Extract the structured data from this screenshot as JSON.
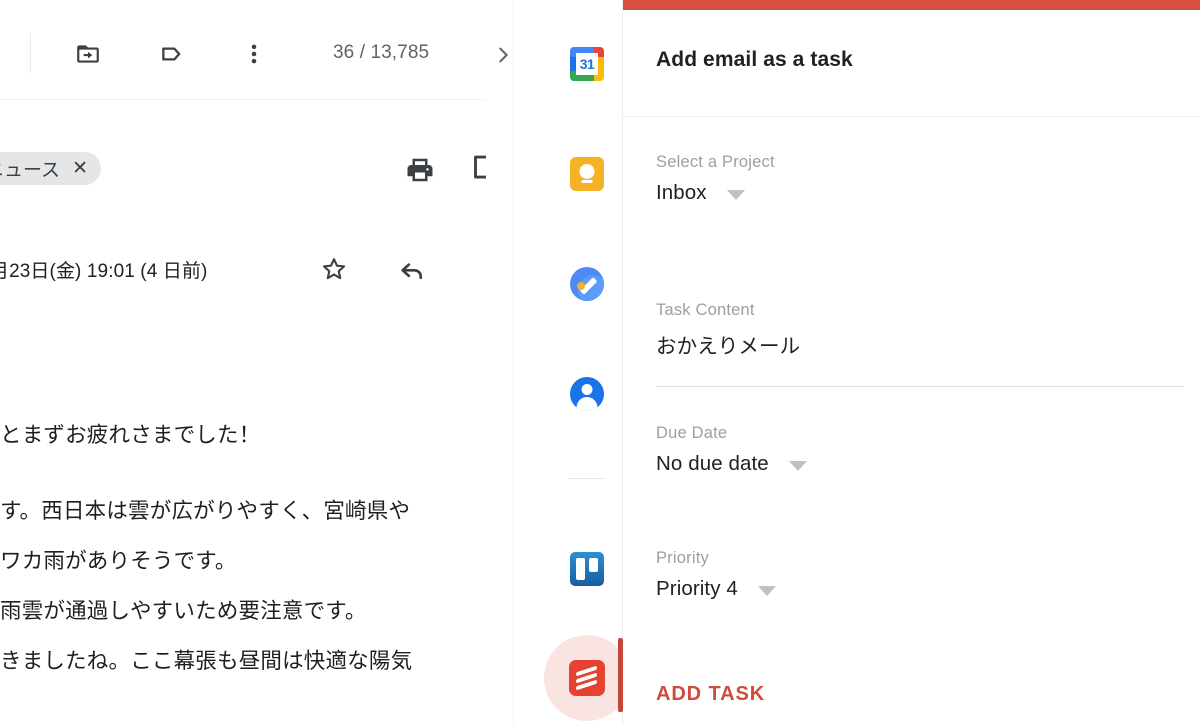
{
  "gmail": {
    "toolbar": {
      "move_to_icon": "move-to-inbox-icon",
      "labels_icon": "label-icon",
      "more_icon": "more-vert-icon",
      "message_counter": "36 / 13,785",
      "next_nav_icon": "chevron-right-icon",
      "separator": "toolbar-divider"
    },
    "message": {
      "label_chip": "ーニュース",
      "label_chip_remove": "✕",
      "print_icon": "print-icon",
      "popout_icon": "open-in-new-icon",
      "date": "月23日(金) 19:01 (4 日前)",
      "star_icon": "star-outline-icon",
      "reply_icon": "reply-icon",
      "body_lines": [
        "とまずお疲れさまでした！",
        "",
        "す。西日本は雲が広がりやすく、宮崎県や",
        "ワカ雨がありそうです。",
        "雨雲が通過しやすいため要注意です。",
        "きましたね。ここ幕張も昼間は快適な陽気"
      ]
    },
    "scrollbar": {
      "name": "vertical-scrollbar",
      "thumb_color": "#c9c9c9"
    }
  },
  "rail": {
    "items": [
      {
        "label": "Google Calendar",
        "icon": "google-calendar-icon",
        "day": "31",
        "active": false
      },
      {
        "label": "Google Keep",
        "icon": "google-keep-icon",
        "active": false
      },
      {
        "label": "Google Tasks",
        "icon": "google-tasks-icon",
        "active": false
      },
      {
        "label": "Google Contacts",
        "icon": "google-contacts-icon",
        "active": false
      },
      {
        "label": "Trello",
        "icon": "trello-icon",
        "active": false
      },
      {
        "label": "Todoist",
        "icon": "todoist-icon",
        "active": true
      }
    ],
    "divider": "rail-divider"
  },
  "panel": {
    "accent_color": "#d94f41",
    "title": "Add email as a task",
    "fields": [
      {
        "label": "Select a Project",
        "value": "Inbox",
        "has_caret": true,
        "has_underline": false
      },
      {
        "label": "Task Content",
        "value": "おかえりメール",
        "has_caret": false,
        "has_underline": true
      },
      {
        "label": "Due Date",
        "value": "No due date",
        "has_caret": true,
        "has_underline": false
      },
      {
        "label": "Priority",
        "value": "Priority 4",
        "has_caret": true,
        "has_underline": false
      }
    ],
    "submit_label": "ADD TASK",
    "submit_color": "#d04b3c"
  }
}
